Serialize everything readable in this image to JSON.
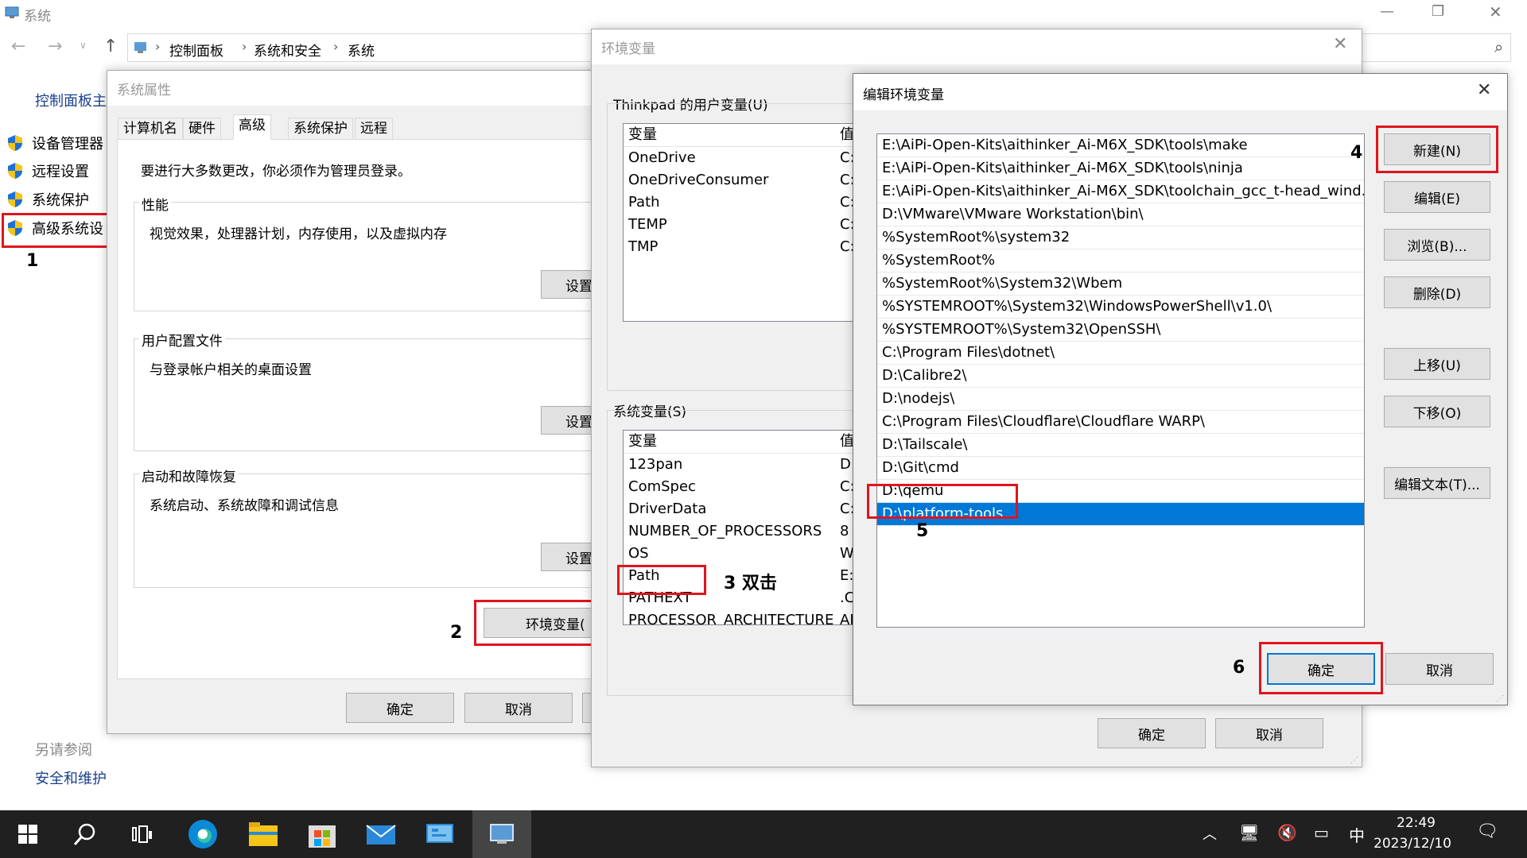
{
  "window": {
    "title": "系统",
    "breadcrumb": [
      "控制面板",
      "系统和安全",
      "系统"
    ],
    "minimize": "—",
    "maximize": "❐",
    "close": "✕"
  },
  "sidebar": {
    "home": "控制面板主",
    "items": [
      {
        "label": "设备管理器"
      },
      {
        "label": "远程设置"
      },
      {
        "label": "系统保护"
      },
      {
        "label": "高级系统设"
      }
    ],
    "see_also": "另请参阅",
    "security": "安全和维护"
  },
  "sysprops": {
    "title": "系统属性",
    "tabs": [
      "计算机名",
      "硬件",
      "高级",
      "系统保护",
      "远程"
    ],
    "admin_note": "要进行大多数更改，你必须作为管理员登录。",
    "perf_title": "性能",
    "perf_desc": "视觉效果，处理器计划，内存使用，以及虚拟内存",
    "profile_title": "用户配置文件",
    "profile_desc": "与登录帐户相关的桌面设置",
    "startup_title": "启动和故障恢复",
    "startup_desc": "系统启动、系统故障和调试信息",
    "settings_label": "设置",
    "env_button": "环境变量(",
    "ok": "确定",
    "cancel": "取消"
  },
  "envvars": {
    "title": "环境变量",
    "user_group": "Thinkpad 的用户变量(U)",
    "col_var": "变量",
    "col_val": "值",
    "user_vars": [
      {
        "name": "OneDrive",
        "val": "C:"
      },
      {
        "name": "OneDriveConsumer",
        "val": "C:"
      },
      {
        "name": "Path",
        "val": "C:"
      },
      {
        "name": "TEMP",
        "val": "C:"
      },
      {
        "name": "TMP",
        "val": "C:"
      }
    ],
    "sys_group": "系统变量(S)",
    "sys_vars": [
      {
        "name": "123pan",
        "val": "D:"
      },
      {
        "name": "ComSpec",
        "val": "C:"
      },
      {
        "name": "DriverData",
        "val": "C:"
      },
      {
        "name": "NUMBER_OF_PROCESSORS",
        "val": "8"
      },
      {
        "name": "OS",
        "val": "W"
      },
      {
        "name": "Path",
        "val": "E:\\"
      },
      {
        "name": "PATHEXT",
        "val": ".C"
      },
      {
        "name": "PROCESSOR_ARCHITECTURE",
        "val": "AI"
      }
    ],
    "ok": "确定",
    "cancel": "取消"
  },
  "editenv": {
    "title": "编辑环境变量",
    "paths": [
      "E:\\AiPi-Open-Kits\\aithinker_Ai-M6X_SDK\\tools\\make",
      "E:\\AiPi-Open-Kits\\aithinker_Ai-M6X_SDK\\tools\\ninja",
      "E:\\AiPi-Open-Kits\\aithinker_Ai-M6X_SDK\\toolchain_gcc_t-head_wind...",
      "D:\\VMware\\VMware Workstation\\bin\\",
      "%SystemRoot%\\system32",
      "%SystemRoot%",
      "%SystemRoot%\\System32\\Wbem",
      "%SYSTEMROOT%\\System32\\WindowsPowerShell\\v1.0\\",
      "%SYSTEMROOT%\\System32\\OpenSSH\\",
      "C:\\Program Files\\dotnet\\",
      "D:\\Calibre2\\",
      "D:\\nodejs\\",
      "C:\\Program Files\\Cloudflare\\Cloudflare WARP\\",
      "D:\\Tailscale\\",
      "D:\\Git\\cmd",
      "D:\\qemu",
      "D:\\platform-tools"
    ],
    "buttons": {
      "new": "新建(N)",
      "edit": "编辑(E)",
      "browse": "浏览(B)...",
      "delete": "删除(D)",
      "up": "上移(U)",
      "down": "下移(O)",
      "edit_text": "编辑文本(T)...",
      "ok": "确定",
      "cancel": "取消"
    }
  },
  "annotations": {
    "n1": "1",
    "n2": "2",
    "n3": "3 双击",
    "n4": "4",
    "n5": "5",
    "n6": "6"
  },
  "taskbar": {
    "time": "22:49",
    "date": "2023/12/10",
    "ime": "中"
  },
  "colors": {
    "accent": "#0078d7",
    "annotation": "#e0141e",
    "taskbar": "#202020"
  }
}
